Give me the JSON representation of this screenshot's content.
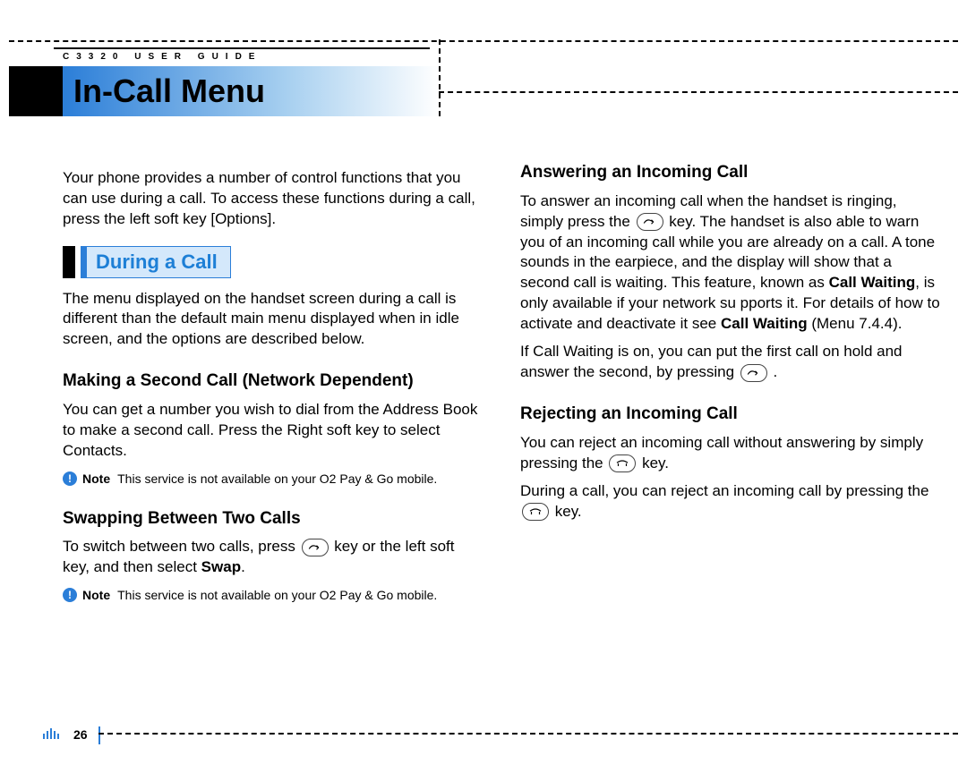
{
  "running_head": "C3320 USER GUIDE",
  "title": "In-Call Menu",
  "page_number": "26",
  "left": {
    "intro": "Your phone provides a number of control functions that you can use during a call. To access these functions during a call, press the left soft key [Options].",
    "section_label": "During a Call",
    "during_intro": "The menu displayed on the handset screen during a call is different than the default main menu displayed when in idle screen, and the options are described below.",
    "h_second": "Making a Second Call (Network Dependent)",
    "p_second": "You can get a number you wish to dial from the Address Book to make a second call. Press the Right soft key to select Contacts.",
    "note_label": "Note",
    "note1": "This service is not available on your O2 Pay & Go mobile.",
    "h_swap": "Swapping Between Two Calls",
    "swap_a": "To switch between two calls, press ",
    "swap_b": " key or the left soft key, and then select ",
    "swap_bold": "Swap",
    "swap_c": ".",
    "note2": "This service is not available on your O2 Pay & Go mobile."
  },
  "right": {
    "h_answer": "Answering an Incoming Call",
    "ans_a": "To answer an incoming call when the handset is ringing, simply press the ",
    "ans_b": " key. The handset is also able to warn you of an incoming call while you are already on a call. A tone sounds in the earpiece, and the display will show that a second call is waiting. This feature, known as ",
    "ans_bold1": "Call Waiting",
    "ans_c": ", is only available if your network su pports it. For details of how to activate and deactivate it see ",
    "ans_bold2": "Call Waiting",
    "ans_d": " (Menu 7.4.4).",
    "cw_a": "If Call Waiting is on, you can put the first call on hold and answer the second, by pressing ",
    "cw_b": " .",
    "h_reject": "Rejecting an Incoming Call",
    "rej_a": "You can reject an incoming call without answering by simply pressing the ",
    "rej_b": " key.",
    "rej2_a": "During a call, you can reject an incoming call by pressing the ",
    "rej2_b": " key."
  }
}
